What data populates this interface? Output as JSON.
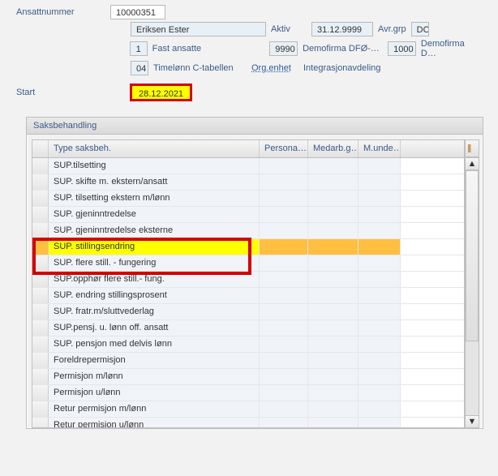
{
  "form": {
    "ansatt_label": "Ansattnummer",
    "ansatt_value": "10000351",
    "name_value": "Eriksen Ester",
    "status_label": "Aktiv",
    "avrgrp_date": "31.12.9999",
    "avrgrp_label": "Avr.grp",
    "avrgrp_code": "DO",
    "emptype_code": "1",
    "emptype_text": "Fast ansatte",
    "company_code": "9990",
    "company_text": "Demofirma DFØ-…",
    "company2_code": "1000",
    "company2_text": "Demofirma D…",
    "wage_code": "04",
    "wage_text": "Timelønn C-tabellen",
    "orgunit_label": "Org.enhet",
    "orgunit_text": "Integrasjonavdeling",
    "start_label": "Start",
    "start_value": "28.12.2021"
  },
  "panel": {
    "title": "Saksbehandling",
    "columns": {
      "type": "Type saksbeh.",
      "a": "Persona…",
      "b": "Medarb.g…",
      "c": "M.unde…"
    },
    "rows": [
      {
        "t": "SUP.tilsetting"
      },
      {
        "t": "SUP. skifte m. ekstern/ansatt"
      },
      {
        "t": "SUP. tilsetting ekstern m/lønn"
      },
      {
        "t": "SUP. gjeninntredelse"
      },
      {
        "t": "SUP. gjeninntredelse eksterne"
      },
      {
        "t": "SUP. stillingsendring",
        "sel": true
      },
      {
        "t": "SUP. flere still. - fungering"
      },
      {
        "t": "SUP.opphør flere still.- fung."
      },
      {
        "t": "SUP. endring stillingsprosent"
      },
      {
        "t": "SUP. fratr.m/sluttvederlag"
      },
      {
        "t": "SUP.pensj. u. lønn off. ansatt"
      },
      {
        "t": "SUP. pensjon med delvis lønn"
      },
      {
        "t": "Foreldrepermisjon"
      },
      {
        "t": "Permisjon m/lønn"
      },
      {
        "t": "Permisjon u/lønn"
      },
      {
        "t": "Retur permisjon m/lønn"
      },
      {
        "t": "Retur permisjon u/lønn"
      }
    ]
  }
}
